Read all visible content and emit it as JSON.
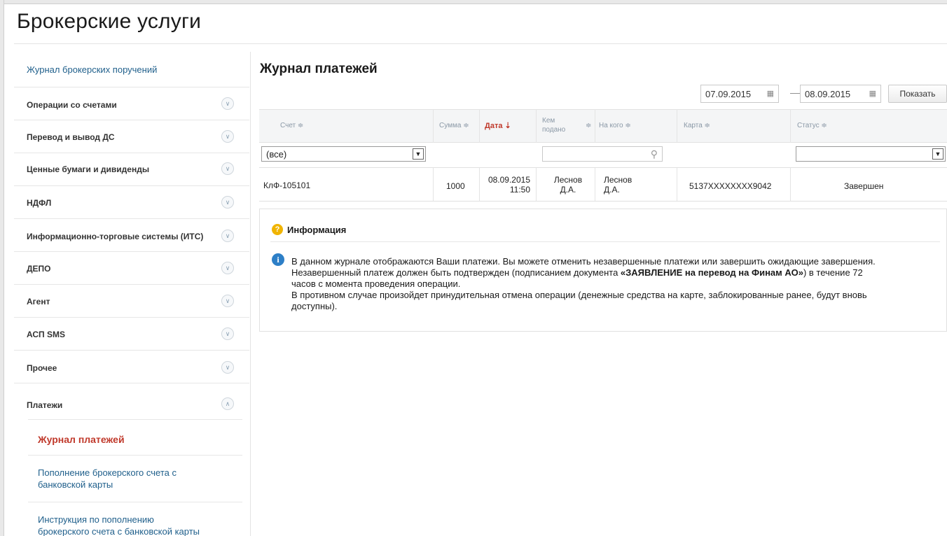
{
  "app": {
    "title": "Брокерские услуги"
  },
  "sidebar": {
    "top_link": "Журнал брокерских поручений",
    "sections": [
      {
        "label": "Операции со счетами",
        "expanded": false
      },
      {
        "label": "Перевод и вывод ДС",
        "expanded": false
      },
      {
        "label": "Ценные бумаги и дивиденды",
        "expanded": false
      },
      {
        "label": "НДФЛ",
        "expanded": false
      },
      {
        "label": "Информационно-торговые системы (ИТС)",
        "expanded": false
      },
      {
        "label": "ДЕПО",
        "expanded": false
      },
      {
        "label": "Агент",
        "expanded": false
      },
      {
        "label": "АСП SMS",
        "expanded": false
      },
      {
        "label": "Прочее",
        "expanded": false
      },
      {
        "label": "Платежи",
        "expanded": true
      }
    ],
    "sub_items": [
      {
        "label": "Журнал платежей",
        "active": true
      },
      {
        "label_line1": "Пополнение брокерского счета с",
        "label_line2": "банковской карты",
        "active": false
      },
      {
        "label_line1": "Инструкция по пополнению",
        "label_line2": "брокерского счета с банковской карты",
        "active": false
      }
    ],
    "icons": {
      "collapsed": "chevron-down-icon",
      "expanded": "chevron-up-icon"
    }
  },
  "main": {
    "title": "Журнал платежей",
    "date_from": "07.09.2015",
    "date_to": "08.09.2015",
    "date_separator": "—",
    "show_button": "Показать",
    "table": {
      "columns": {
        "account": "Счет ≑",
        "amount": "Сумма ≑",
        "date": "Дата ⇣",
        "submitted_by_line1": "Кем",
        "submitted_by_line2": "подано",
        "submitted_by_sort": "≑",
        "for_whom": "На кого ≑",
        "card": "Карта ≑",
        "status": "Статус ≑"
      },
      "filters": {
        "account": "(все)",
        "status": ""
      },
      "rows": [
        {
          "account": "КлФ-105101",
          "amount": "1000",
          "date_line1": "08.09.2015",
          "date_line2": "11:50",
          "submitted_by_line1": "Леснов",
          "submitted_by_line2": "Д.А.",
          "for_whom_line1": "Леснов",
          "for_whom_line2": "Д.А.",
          "card": "5137XXXXXXXX9042",
          "status": "Завершен"
        }
      ]
    },
    "info": {
      "title": "Информация",
      "line1": "В данном журнале отображаются Ваши платежи. Вы можете отменить незавершенные платежи или завершить ожидающие завершения.",
      "line2_before": "Незавершенный платеж должен быть подтвержден (подписанием документа ",
      "line2_bold": "«ЗАЯВЛЕНИЕ на перевод на Финам АО»",
      "line2_after": ") в течение 72",
      "line3": "часов с момента проведения операции.",
      "line4": "В противном случае произойдет принудительная отмена операции (денежные средства на карте, заблокированные ранее, будут вновь",
      "line5": "доступны)."
    }
  },
  "colors": {
    "link": "#1f5f8b",
    "active": "#c0392b",
    "info_icon": "#2d7fc7",
    "question_icon": "#f0b400"
  }
}
